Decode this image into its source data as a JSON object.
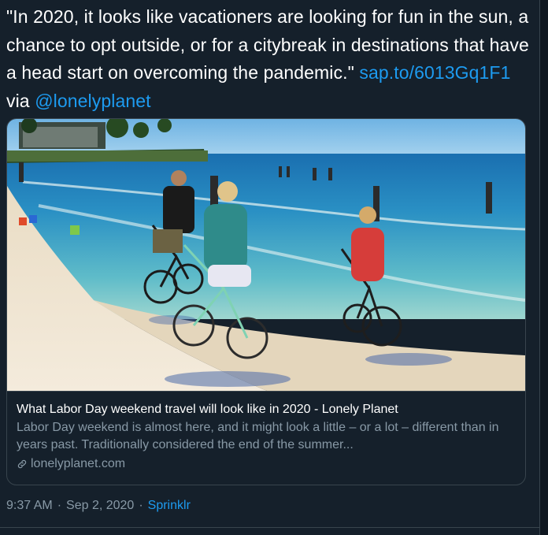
{
  "tweet": {
    "text_before": "\"In 2020, it looks like vacationers are looking for fun in the sun, a chance to opt outside, or for a citybreak in destinations that have a head start on overcoming the pandemic.\" ",
    "link": "sap.to/6013Gq1F1",
    "via": " via ",
    "mention": "@lonelyplanet"
  },
  "card": {
    "image_icon": "beach-bicycles-photo",
    "title": "What Labor Day weekend travel will look like in 2020 - Lonely Planet",
    "description": "Labor Day weekend is almost here, and it might look a little – or a lot – different than in years past. Traditionally considered the end of the summer...",
    "domain_icon": "link-icon",
    "domain": "lonelyplanet.com"
  },
  "meta": {
    "time": "9:37 AM",
    "separator": "·",
    "date": "Sep 2, 2020",
    "source": "Sprinklr"
  },
  "colors": {
    "background": "#15202b",
    "link": "#1d9bf0",
    "muted": "#8899a6",
    "border": "#38444d"
  }
}
